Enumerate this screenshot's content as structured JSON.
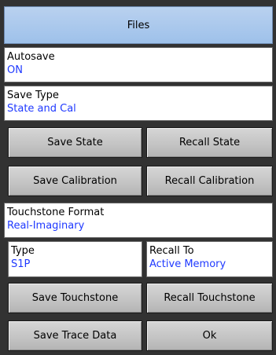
{
  "header": {
    "title": "Files"
  },
  "autosave": {
    "label": "Autosave",
    "value": "ON"
  },
  "save_type": {
    "label": "Save Type",
    "value": "State and Cal"
  },
  "buttons": {
    "save_state": "Save State",
    "recall_state": "Recall State",
    "save_calibration": "Save Calibration",
    "recall_calibration": "Recall Calibration",
    "save_touchstone": "Save Touchstone",
    "recall_touchstone": "Recall Touchstone",
    "save_trace_data": "Save Trace Data",
    "ok": "Ok"
  },
  "touchstone_format": {
    "label": "Touchstone Format",
    "value": "Real-Imaginary"
  },
  "type": {
    "label": "Type",
    "value": "S1P"
  },
  "recall_to": {
    "label": "Recall To",
    "value": "Active Memory"
  },
  "colors": {
    "header_bg": "#a8c7ec",
    "value_text": "#1f39ff",
    "button_bg": "#c6c6c6",
    "panel_bg": "#323232"
  }
}
